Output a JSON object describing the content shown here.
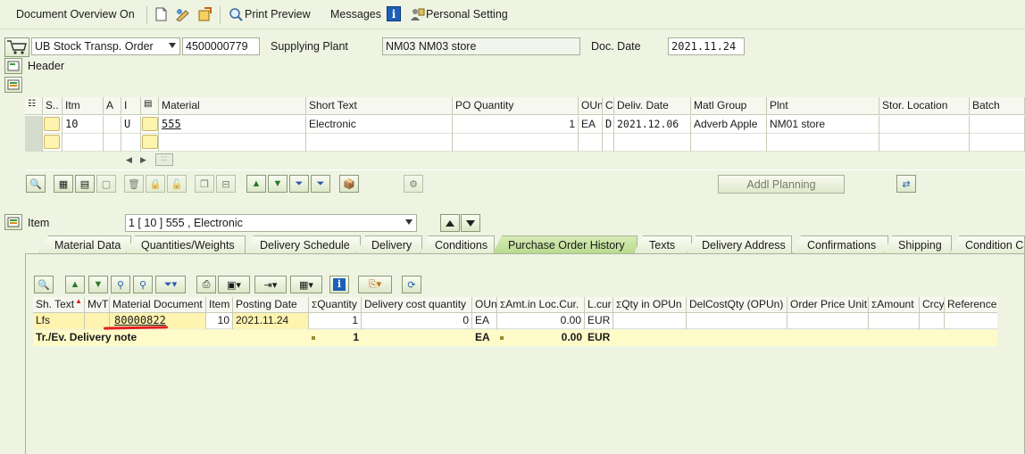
{
  "toolbar": {
    "doc_overview": "Document Overview On",
    "print_preview": "Print Preview",
    "messages": "Messages",
    "personal_setting": "Personal Setting"
  },
  "header_row": {
    "order_type": "UB Stock Transp. Order",
    "po_number": "4500000779",
    "supplying_plant_label": "Supplying Plant",
    "supplying_plant_value": "NM03 NM03 store",
    "doc_date_label": "Doc. Date",
    "doc_date_value": "2021.11.24",
    "header_label": "Header"
  },
  "items_table": {
    "columns": [
      "S..",
      "Itm",
      "A",
      "I",
      "Material",
      "Short Text",
      "PO Quantity",
      "OUn",
      "C",
      "Deliv. Date",
      "Matl Group",
      "Plnt",
      "Stor. Location",
      "Batch"
    ],
    "rows": [
      {
        "itm": "10",
        "a": "",
        "i": "U",
        "material": "555",
        "short_text": "Electronic",
        "po_quantity": "1",
        "oun": "EA",
        "c": "D",
        "deliv_date": "2021.12.06",
        "matl_group": "Adverb Apple",
        "plnt": "NM01 store",
        "stor_location": "",
        "batch": ""
      }
    ]
  },
  "addl_planning": "Addl Planning",
  "item_selector": {
    "label": "Item",
    "value": "1 [ 10 ] 555 , Electronic"
  },
  "tabs": [
    "Material Data",
    "Quantities/Weights",
    "Delivery Schedule",
    "Delivery",
    "Conditions",
    "Purchase Order History",
    "Texts",
    "Delivery Address",
    "Confirmations",
    "Shipping",
    "Condition Co"
  ],
  "history_table": {
    "columns": [
      "Sh. Text",
      "MvT",
      "Material Document",
      "Item",
      "Posting Date",
      "Quantity",
      "Delivery cost quantity",
      "OUn",
      "Amt.in Loc.Cur.",
      "L.cur",
      "Qty in OPUn",
      "DelCostQty (OPUn)",
      "Order Price Unit",
      "Amount",
      "Crcy",
      "Reference"
    ],
    "sigma": "Σ",
    "row": {
      "sh_text": "Lfs",
      "mvt": "",
      "material_document": "80000822",
      "item": "10",
      "posting_date": "2021.11.24",
      "quantity": "1",
      "delivery_cost_qty": "0",
      "oun": "EA",
      "amt_loc_cur": "0.00",
      "l_cur": "EUR"
    },
    "total": {
      "label": "Tr./Ev. Delivery note",
      "quantity": "1",
      "oun": "EA",
      "amt_loc_cur": "0.00",
      "l_cur": "EUR"
    }
  },
  "colors": {
    "background": "#eef3e2",
    "active_tab": "#b9da8e",
    "highlight_row": "#fff3b0",
    "annotation": "#e02020"
  }
}
